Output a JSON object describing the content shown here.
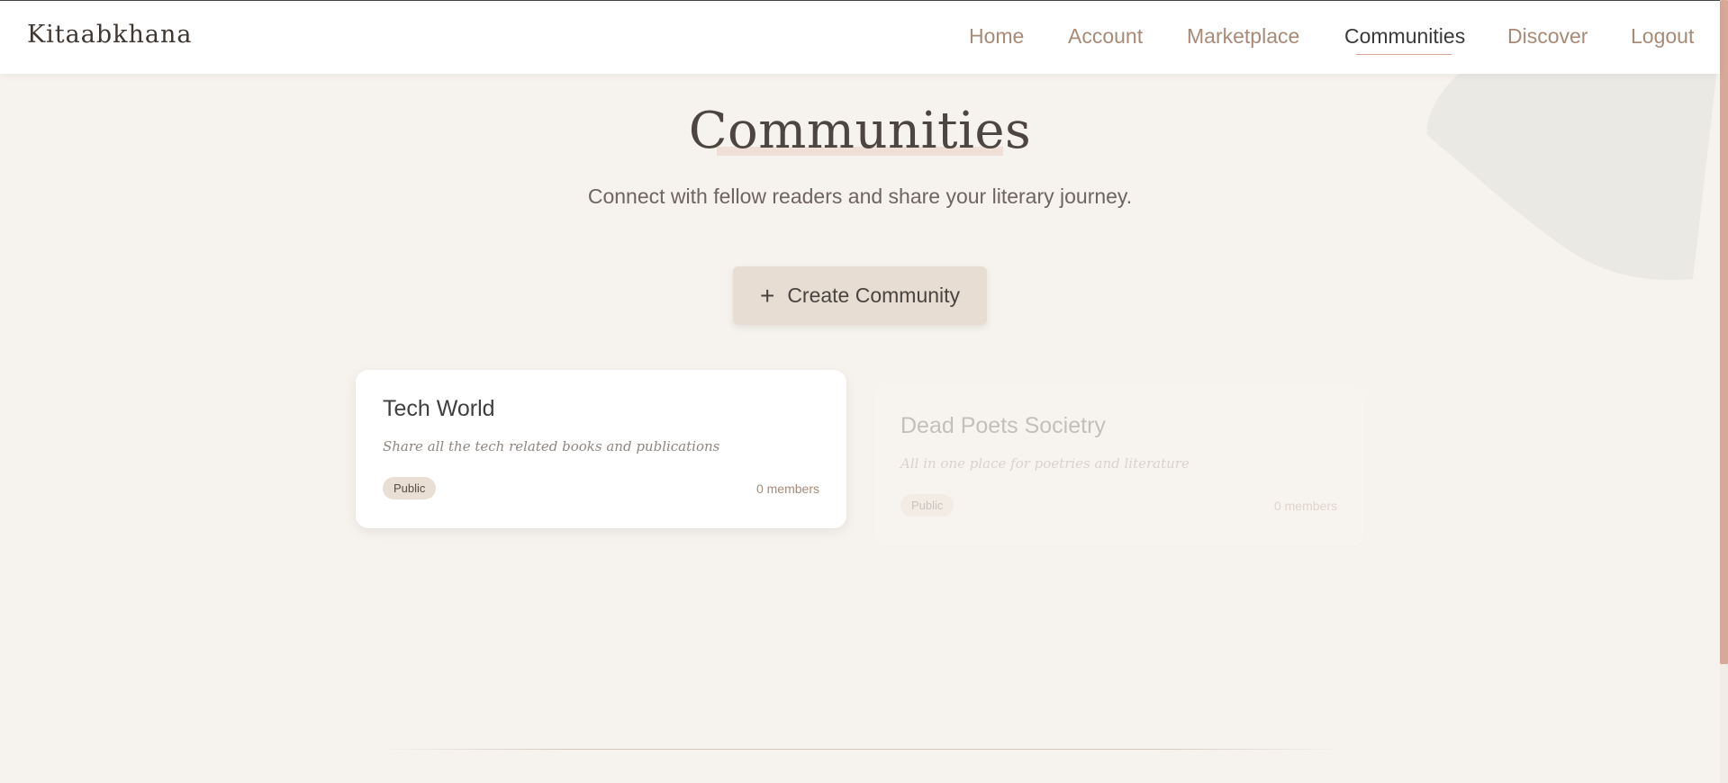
{
  "brand": "Kitaabkhana",
  "nav": {
    "items": [
      {
        "label": "Home"
      },
      {
        "label": "Account"
      },
      {
        "label": "Marketplace"
      },
      {
        "label": "Communities",
        "active": true
      },
      {
        "label": "Discover"
      },
      {
        "label": "Logout"
      }
    ]
  },
  "header": {
    "title": "Communities",
    "subtitle": "Connect with fellow readers and share your literary journey."
  },
  "create_button": {
    "icon": "plus-icon",
    "label": "Create Community"
  },
  "communities": [
    {
      "name": "Tech World",
      "description": "Share all the tech related books and publications",
      "visibility": "Public",
      "members": "0 members"
    },
    {
      "name": "Dead Poets Societry",
      "description": "All in one place for poetries and literature",
      "visibility": "Public",
      "members": "0 members"
    }
  ],
  "colors": {
    "background": "#f6f2ed",
    "accent": "#a88a77",
    "button": "#e8ddd2",
    "scrollbar": "#d7a996"
  }
}
